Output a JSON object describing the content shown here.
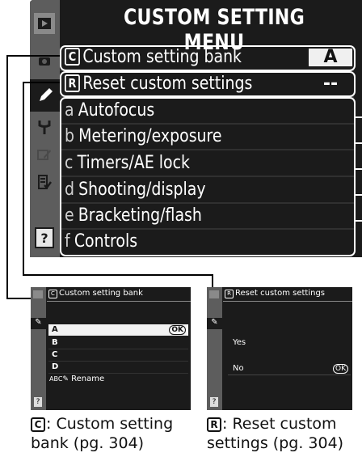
{
  "main_menu": {
    "title": "CUSTOM SETTING MENU",
    "rows": [
      {
        "icon": "C",
        "label": "Custom setting bank",
        "value": "A"
      },
      {
        "icon": "R",
        "label": "Reset custom settings",
        "value": "--"
      },
      {
        "letter": "a",
        "label": "Autofocus"
      },
      {
        "letter": "b",
        "label": "Metering/exposure"
      },
      {
        "letter": "c",
        "label": "Timers/AE lock"
      },
      {
        "letter": "d",
        "label": "Shooting/display"
      },
      {
        "letter": "e",
        "label": "Bracketing/flash"
      },
      {
        "letter": "f",
        "label": "Controls"
      }
    ],
    "side_tabs": [
      "playback-tab-icon",
      "shooting-tab-icon",
      "custom-setting-tab-icon",
      "setup-tab-icon",
      "retouch-tab-icon",
      "my-menu-tab-icon",
      "help-icon"
    ]
  },
  "bank_screen": {
    "title_icon": "C",
    "title": "Custom setting bank",
    "items": [
      "A",
      "B",
      "C",
      "D"
    ],
    "rename_prefix": "ABC",
    "rename": "Rename",
    "ok": "OK"
  },
  "reset_screen": {
    "title_icon": "R",
    "title": "Reset custom settings",
    "yes": "Yes",
    "no": "No",
    "ok": "OK"
  },
  "captions": {
    "bank_icon": "C",
    "bank_line1": ": Custom setting",
    "bank_line2": "bank (pg. 304)",
    "reset_icon": "R",
    "reset_line1": ": Reset custom",
    "reset_line2": "settings (pg. 304)"
  },
  "colors": {
    "screen_bg": "#1b1b1b",
    "side_bar": "#5d5d5d",
    "highlight": "#ffffff",
    "help_bg": "#c8a600"
  }
}
